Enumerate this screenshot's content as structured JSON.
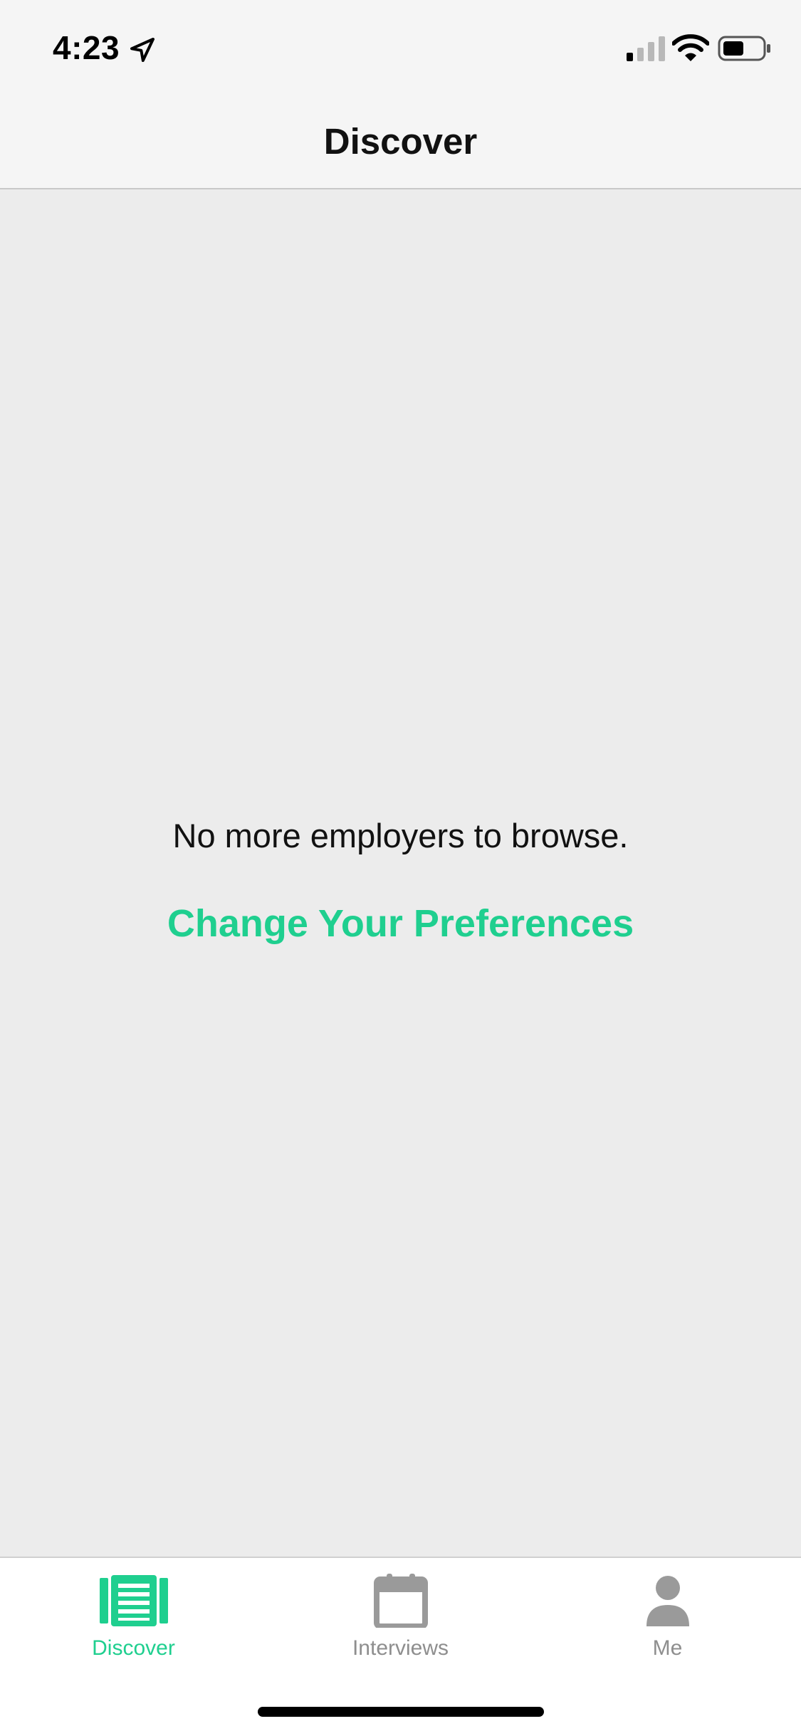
{
  "status_bar": {
    "time": "4:23",
    "icons": [
      "location-arrow-icon",
      "cellular-signal-icon",
      "wifi-icon",
      "battery-icon"
    ]
  },
  "nav": {
    "title": "Discover"
  },
  "main": {
    "empty_message": "No more employers to browse.",
    "action_label": "Change Your Preferences"
  },
  "tabs": [
    {
      "label": "Discover",
      "icon": "discover-list-icon",
      "active": true
    },
    {
      "label": "Interviews",
      "icon": "calendar-icon",
      "active": false
    },
    {
      "label": "Me",
      "icon": "person-icon",
      "active": false
    }
  ],
  "colors": {
    "accent": "#1fcf8f",
    "inactive": "#8e8e8e",
    "background": "#ececec",
    "bar_background": "#f5f5f5"
  }
}
